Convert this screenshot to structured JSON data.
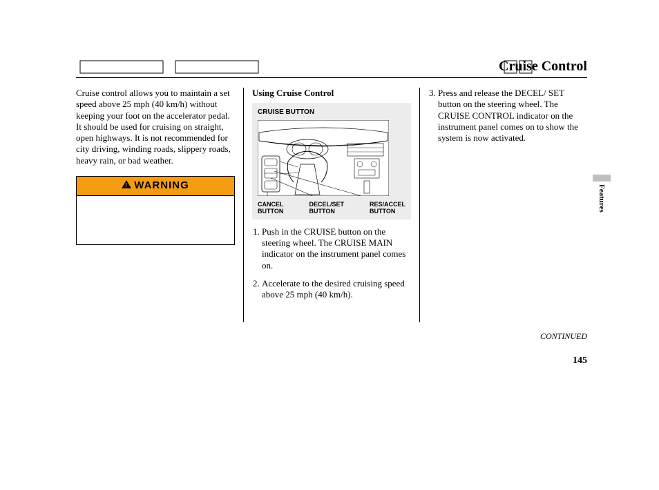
{
  "header": {
    "title": "Cruise Control"
  },
  "col1": {
    "intro": "Cruise control allows you to maintain a set speed above 25 mph (40 km/h) without keeping your foot on the accelerator pedal. It should be used for cruising on straight, open highways. It is not recommended for city driving, winding roads, slippery roads, heavy rain, or bad weather.",
    "warning_label": "WARNING"
  },
  "col2": {
    "section_head": "Using Cruise Control",
    "diagram": {
      "top_label": "CRUISE BUTTON",
      "bottom_labels": {
        "cancel": "CANCEL BUTTON",
        "decel": "DECEL/SET BUTTON",
        "res": "RES/ACCEL BUTTON"
      }
    },
    "steps": {
      "s1": "Push in the CRUISE button on the steering wheel. The CRUISE MAIN indicator on the instrument panel comes on.",
      "s2": "Accelerate to the desired cruising speed above 25 mph (40 km/h)."
    }
  },
  "col3": {
    "steps": {
      "s3": "Press and release the DECEL/ SET button on the steering wheel. The CRUISE CONTROL indicator on the instrument panel comes on to show the system is now activated."
    }
  },
  "side_tab": "Features",
  "continued": "CONTINUED",
  "page_number": "145"
}
